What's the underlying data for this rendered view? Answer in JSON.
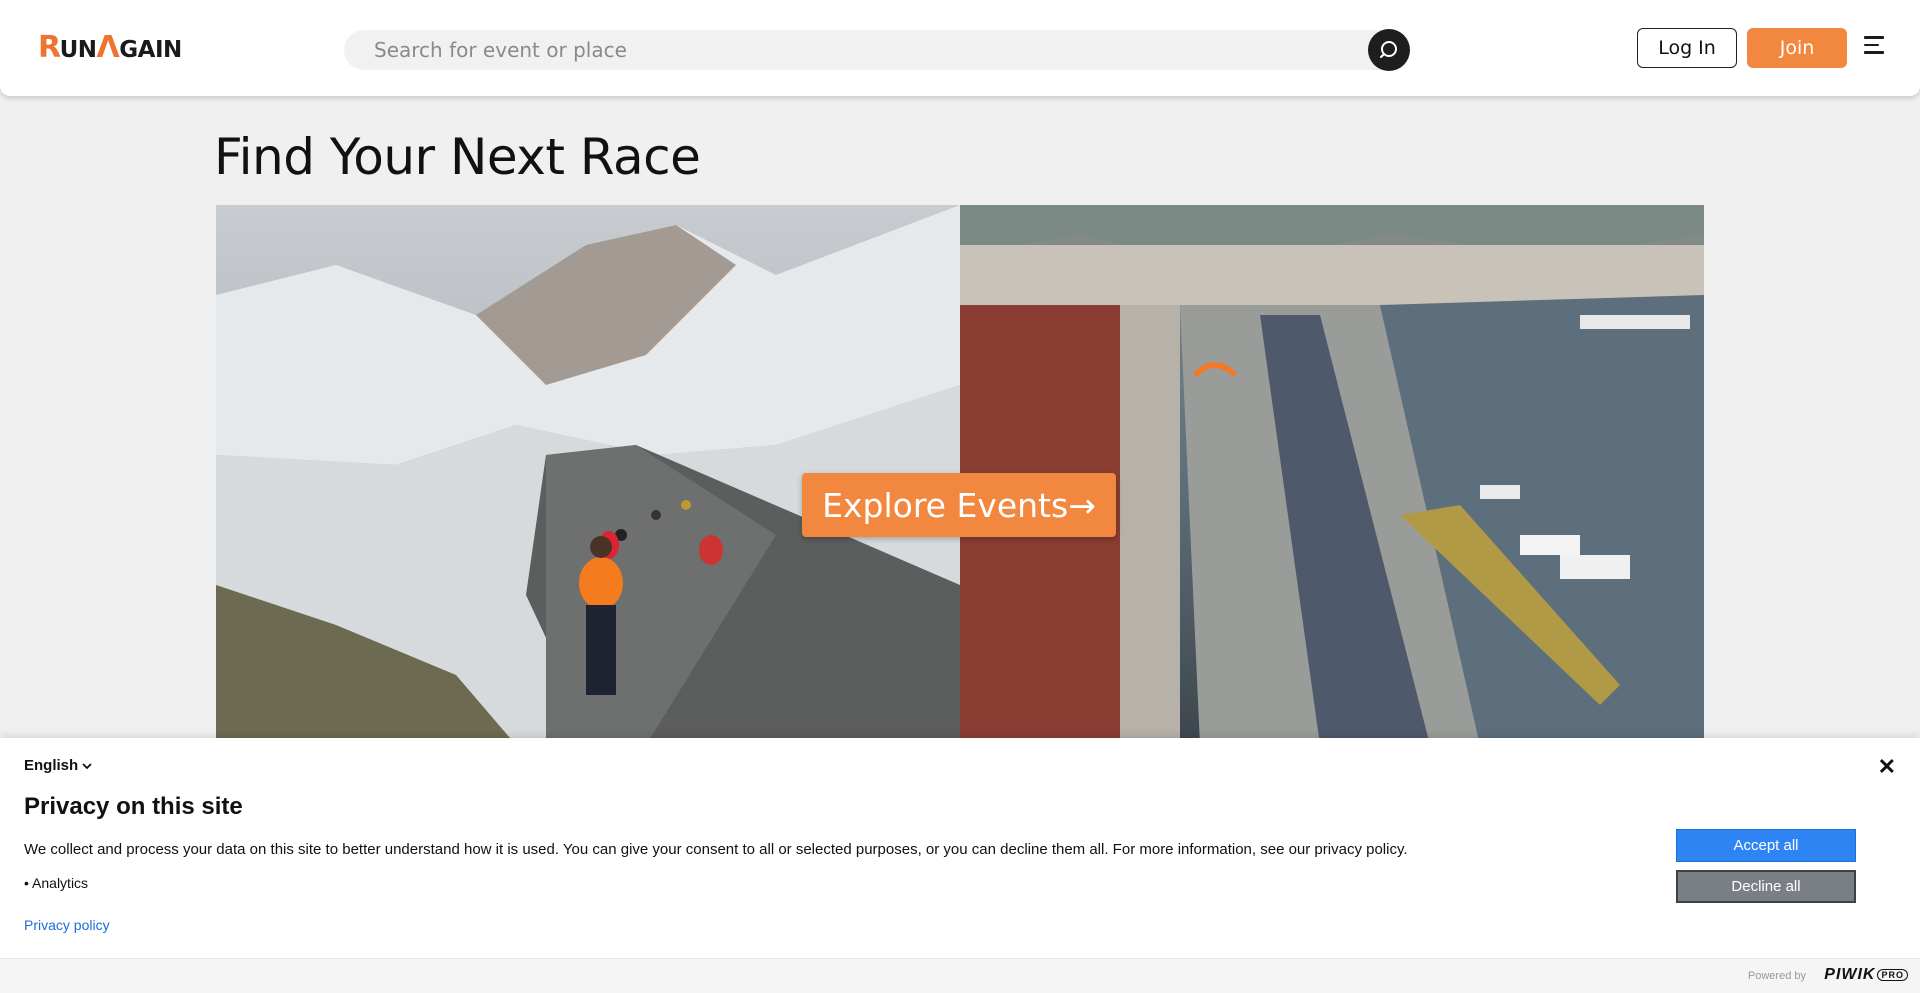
{
  "header": {
    "logo_text_r": "R",
    "logo_text_un": "UN",
    "logo_text_a": "Λ",
    "logo_text_gain": "GAIN",
    "search_placeholder": "Search for event or place",
    "search_icon": "search-icon",
    "login_label": "Log In",
    "join_label": "Join",
    "menu_icon": "hamburger-menu-icon"
  },
  "main": {
    "title": "Find Your Next Race",
    "explore_label": "Explore Events→"
  },
  "consent": {
    "language": "English",
    "title": "Privacy on this site",
    "text": "We collect and process your data on this site to better understand how it is used. You can give your consent to all or selected purposes, or you can decline them all. For more information, see our privacy policy.",
    "purposes": [
      "Analytics"
    ],
    "privacy_link": "Privacy policy",
    "accept_label": "Accept all",
    "decline_label": "Decline all",
    "powered_by": "Powered by",
    "brand": "PIWIK",
    "brand_suffix": "PRO"
  },
  "colors": {
    "accent": "#f2873f",
    "accept_blue": "#2d84f2",
    "decline_gray": "#7a7f85"
  }
}
